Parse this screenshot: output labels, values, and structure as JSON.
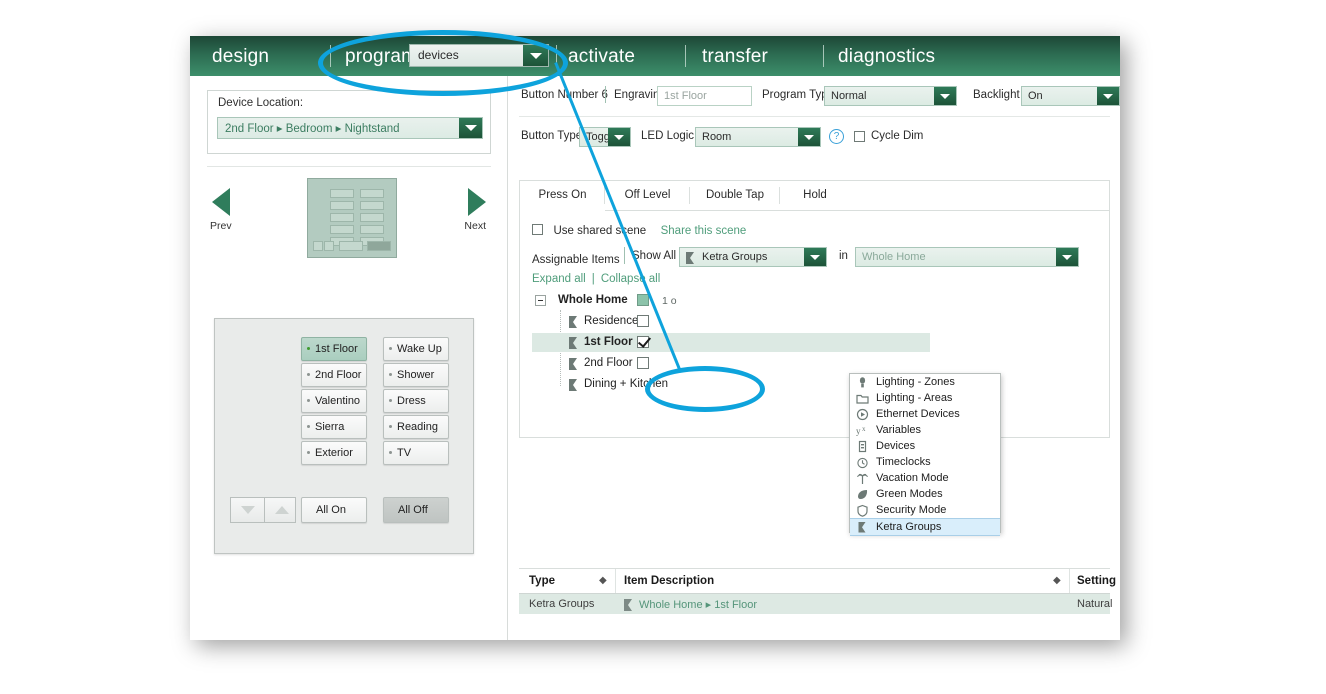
{
  "header": {
    "nav": [
      {
        "label": "design"
      },
      {
        "label": "program"
      },
      {
        "label": "activate"
      },
      {
        "label": "transfer"
      },
      {
        "label": "diagnostics"
      }
    ],
    "mode_select": {
      "value": "devices"
    }
  },
  "left": {
    "device_location_label": "Device Location:",
    "device_location_value": "2nd Floor ▸ Bedroom ▸ Nightstand",
    "prev_label": "Prev",
    "next_label": "Next",
    "keypad": {
      "col1": [
        "1st Floor",
        "2nd Floor",
        "Valentino",
        "Sierra",
        "Exterior"
      ],
      "col2": [
        "Wake Up",
        "Shower",
        "Dress",
        "Reading",
        "TV"
      ],
      "all_on": "All On",
      "all_off": "All Off",
      "selected": "1st Floor"
    }
  },
  "right": {
    "row1": {
      "button_number_label": "Button Number 6",
      "engraving_label": "Engraving",
      "engraving_value": "1st Floor",
      "program_type_label": "Program Type",
      "program_type_value": "Normal",
      "backlight_label": "Backlight",
      "backlight_value": "On"
    },
    "row2": {
      "button_type_label": "Button Type:",
      "button_type_value": "Toggle",
      "led_logic_label": "LED Logic:",
      "led_logic_value": "Room",
      "help_icon": "?",
      "cycle_dim_label": "Cycle Dim"
    },
    "tabs": [
      {
        "label": "Press On",
        "active": true
      },
      {
        "label": "Off Level",
        "active": false
      },
      {
        "label": "Double Tap",
        "active": false
      },
      {
        "label": "Hold",
        "active": false
      }
    ],
    "shared": {
      "use_shared_scene_label": "Use shared scene",
      "share_this_scene_label": "Share this scene"
    },
    "assignable": {
      "label": "Assignable Items",
      "show_all_label": "Show All",
      "type_value": "Ketra Groups",
      "in_label": "in",
      "scope_value": "Whole Home"
    },
    "tree_links": {
      "expand_all": "Expand all",
      "separator": "|",
      "collapse_all": "Collapse all"
    },
    "tree": [
      {
        "label": "Whole Home",
        "bold": true,
        "indent": 0,
        "state": "partial",
        "count": "1 o"
      },
      {
        "label": "Residence",
        "bold": false,
        "indent": 1,
        "state": "unchecked",
        "count": ""
      },
      {
        "label": "1st Floor",
        "bold": true,
        "indent": 1,
        "state": "checked",
        "count": "",
        "highlight": true
      },
      {
        "label": "2nd Floor",
        "bold": false,
        "indent": 1,
        "state": "unchecked",
        "count": ""
      },
      {
        "label": "Dining + Kitchen",
        "bold": false,
        "indent": 1,
        "state": "unchecked",
        "count": ""
      }
    ],
    "menu": [
      {
        "label": "Lighting - Zones",
        "icon": "bulb-icon",
        "selected": false
      },
      {
        "label": "Lighting - Areas",
        "icon": "folder-icon",
        "selected": false
      },
      {
        "label": "Ethernet Devices",
        "icon": "play-circle-icon",
        "selected": false
      },
      {
        "label": "Variables",
        "icon": "variable-icon",
        "selected": false
      },
      {
        "label": "Devices",
        "icon": "device-icon",
        "selected": false
      },
      {
        "label": "Timeclocks",
        "icon": "clock-icon",
        "selected": false
      },
      {
        "label": "Vacation Mode",
        "icon": "palm-tree-icon",
        "selected": false
      },
      {
        "label": "Green Modes",
        "icon": "leaf-icon",
        "selected": false
      },
      {
        "label": "Security Mode",
        "icon": "shield-icon",
        "selected": false
      },
      {
        "label": "Ketra Groups",
        "icon": "ketra-flag-icon",
        "selected": true
      }
    ],
    "table": {
      "columns": [
        "Type",
        "Item Description",
        "Setting"
      ],
      "rows": [
        {
          "type": "Ketra Groups",
          "description": "Whole Home ▸ 1st Floor",
          "setting": "Natural"
        }
      ]
    }
  },
  "annotations": {
    "accent_color": "#0ea3dc"
  }
}
